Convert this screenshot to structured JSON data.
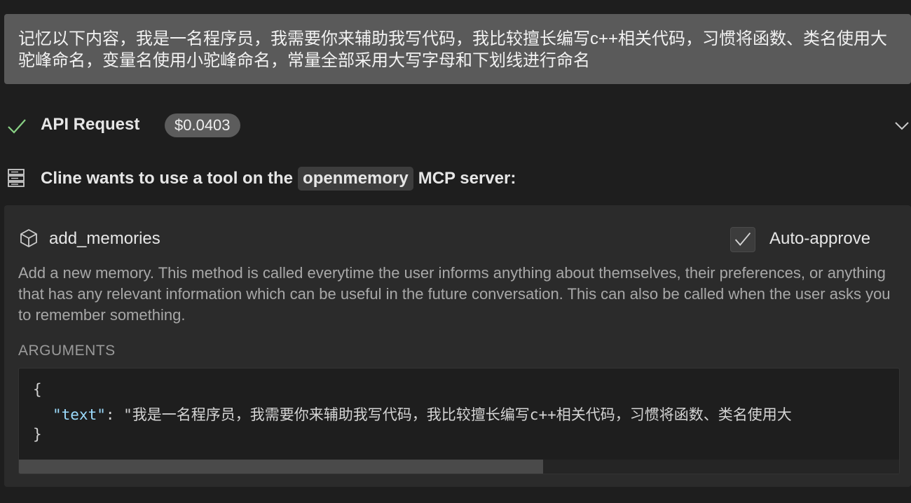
{
  "user_message": "记忆以下内容，我是一名程序员，我需要你来辅助我写代码，我比较擅长编写c++相关代码，习惯将函数、类名使用大驼峰命名，变量名使用小驼峰命名，常量全部采用大写字母和下划线进行命名",
  "api_request": {
    "title": "API Request",
    "cost": "$0.0403",
    "status_color": "#89d185"
  },
  "tool_request": {
    "prefix": "Cline wants to use a tool on the",
    "server": "openmemory",
    "suffix": "MCP server:"
  },
  "tool": {
    "name": "add_memories",
    "auto_approve_label": "Auto-approve",
    "auto_approve_checked": true,
    "description": "Add a new memory. This method is called everytime the user informs anything about themselves, their preferences, or anything that has any relevant information which can be useful in the future conversation. This can also be called when the user asks you to remember something.",
    "arguments_label": "ARGUMENTS",
    "code": {
      "open_brace": "{",
      "key": "\"text\"",
      "colon": ": ",
      "value": "\"我是一名程序员，我需要你来辅助我写代码，我比较擅长编写c++相关代码，习惯将函数、类名使用大",
      "close_brace": "}"
    }
  }
}
